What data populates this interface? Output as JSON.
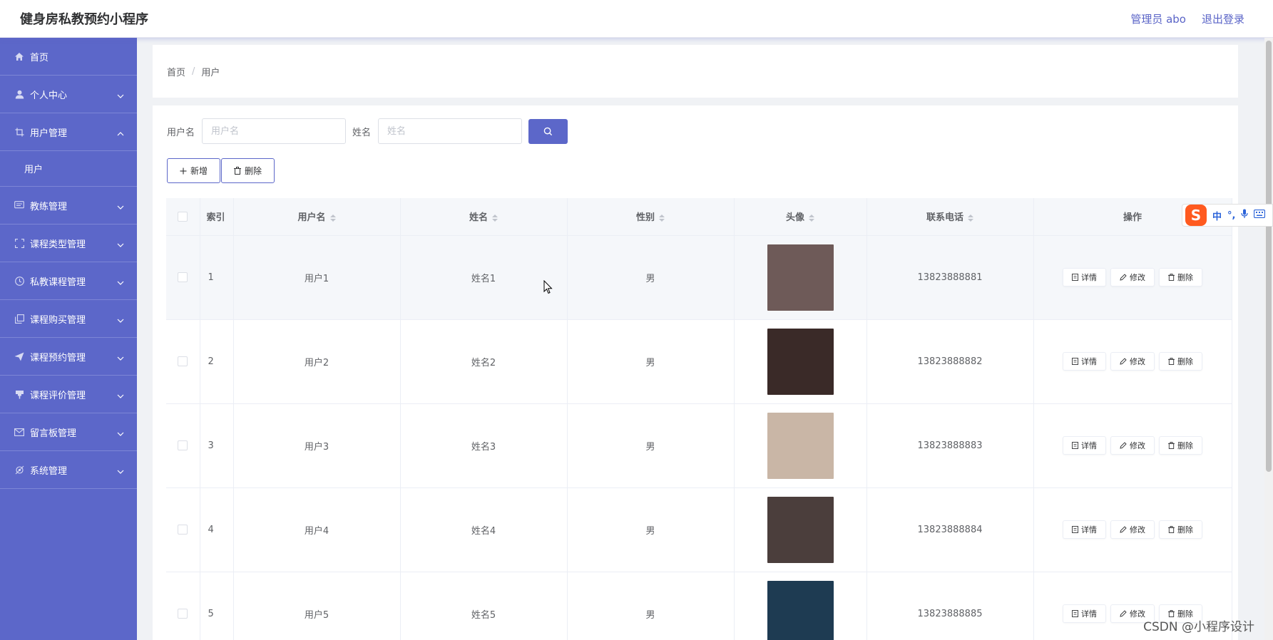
{
  "header": {
    "app_title": "健身房私教预约小程序",
    "user_label": "管理员 abo",
    "logout_label": "退出登录"
  },
  "sidebar": {
    "items": [
      {
        "label": "首页",
        "icon": "home-icon",
        "expanded": null
      },
      {
        "label": "个人中心",
        "icon": "user-icon",
        "expanded": false
      },
      {
        "label": "用户管理",
        "icon": "crop-icon",
        "expanded": true,
        "children": [
          {
            "label": "用户"
          }
        ]
      },
      {
        "label": "教练管理",
        "icon": "chat-icon",
        "expanded": false
      },
      {
        "label": "课程类型管理",
        "icon": "frame-icon",
        "expanded": false
      },
      {
        "label": "私教课程管理",
        "icon": "clock-icon",
        "expanded": false
      },
      {
        "label": "课程购买管理",
        "icon": "copy-icon",
        "expanded": false
      },
      {
        "label": "课程预约管理",
        "icon": "send-icon",
        "expanded": false
      },
      {
        "label": "课程评价管理",
        "icon": "flag-icon",
        "expanded": false
      },
      {
        "label": "留言板管理",
        "icon": "mail-icon",
        "expanded": false
      },
      {
        "label": "系统管理",
        "icon": "gear-icon",
        "expanded": false
      }
    ]
  },
  "breadcrumb": {
    "home": "首页",
    "separator": "/",
    "current": "用户"
  },
  "search": {
    "username_label": "用户名",
    "username_placeholder": "用户名",
    "name_label": "姓名",
    "name_placeholder": "姓名"
  },
  "actions": {
    "add_label": "新增",
    "delete_label": "删除"
  },
  "table": {
    "columns": [
      "索引",
      "用户名",
      "姓名",
      "性别",
      "头像",
      "联系电话",
      "操作"
    ],
    "rows": [
      {
        "index": "1",
        "username": "用户1",
        "name": "姓名1",
        "gender": "男",
        "avatar_color": "#6e5a58",
        "phone": "13823888881"
      },
      {
        "index": "2",
        "username": "用户2",
        "name": "姓名2",
        "gender": "男",
        "avatar_color": "#3a2a28",
        "phone": "13823888882"
      },
      {
        "index": "3",
        "username": "用户3",
        "name": "姓名3",
        "gender": "男",
        "avatar_color": "#c9b6a6",
        "phone": "13823888883"
      },
      {
        "index": "4",
        "username": "用户4",
        "name": "姓名4",
        "gender": "男",
        "avatar_color": "#4b3e3c",
        "phone": "13823888884"
      },
      {
        "index": "5",
        "username": "用户5",
        "name": "姓名5",
        "gender": "男",
        "avatar_color": "#1e3b52",
        "phone": "13823888885"
      }
    ],
    "row_actions": {
      "detail": "详情",
      "edit": "修改",
      "delete": "删除"
    }
  },
  "ime": {
    "mode": "中",
    "punct": "°,"
  },
  "watermark": "CSDN @小程序设计",
  "colors": {
    "accent": "#5c67c9",
    "sidebar_bg": "#5c67c9"
  }
}
